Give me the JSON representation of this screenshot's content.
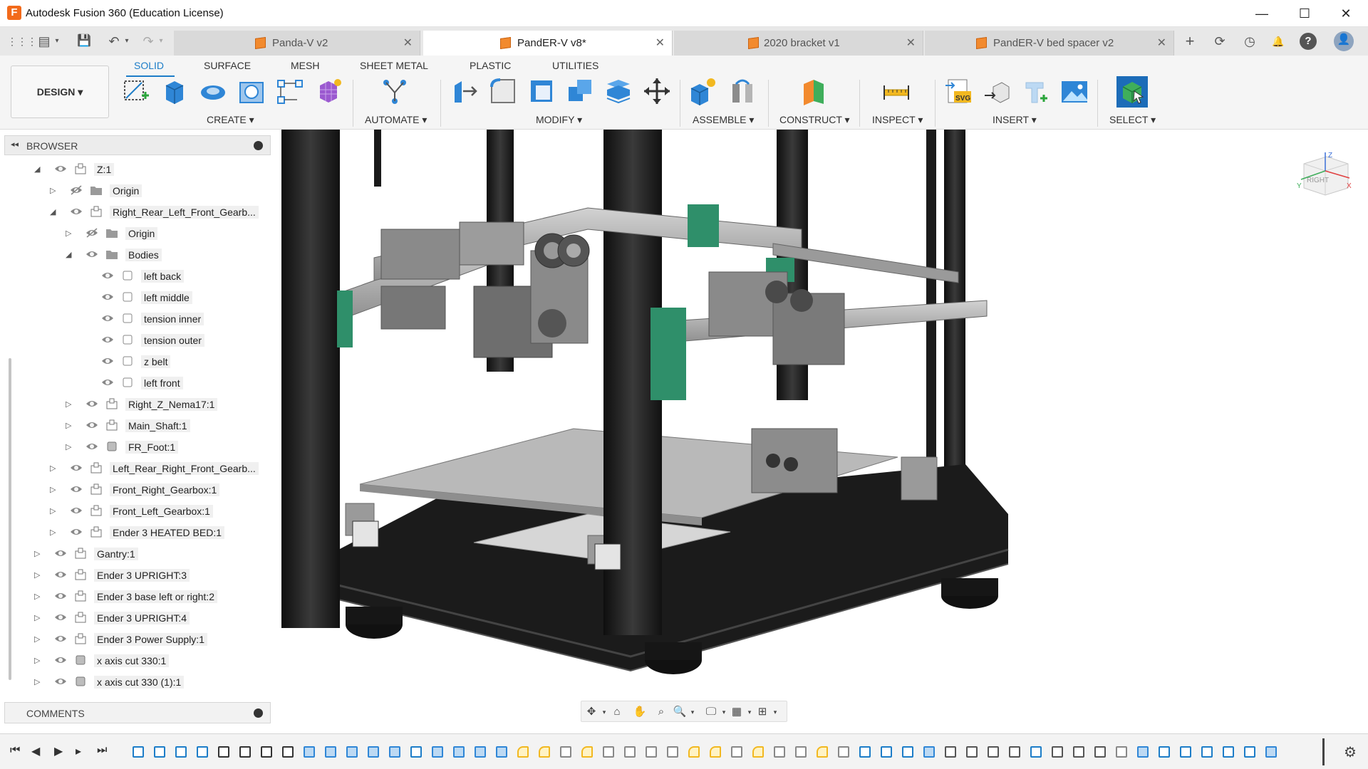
{
  "app": {
    "title": "Autodesk Fusion 360 (Education License)",
    "icon_letter": "F"
  },
  "window_controls": {
    "minimize": "—",
    "maximize": "☐",
    "close": "✕"
  },
  "quick_access": {
    "grid": "⋮⋮⋮",
    "file": "▤",
    "save": "💾",
    "undo": "↶",
    "redo": "↷"
  },
  "tabs": [
    {
      "label": "Panda-V v2",
      "active": false
    },
    {
      "label": "PandER-V v8*",
      "active": true
    },
    {
      "label": "2020 bracket v1",
      "active": false
    },
    {
      "label": "PandER-V bed spacer v2",
      "active": false
    }
  ],
  "tab_close": "✕",
  "right_icons": {
    "new_tab": "+",
    "sync": "⟳",
    "clock": "◷",
    "bell": "🔔",
    "help": "?",
    "avatar": "👤"
  },
  "toolbar": {
    "design_label": "DESIGN ▾",
    "workspace_tabs": [
      "SOLID",
      "SURFACE",
      "MESH",
      "SHEET METAL",
      "PLASTIC",
      "UTILITIES"
    ],
    "active_workspace": "SOLID",
    "groups": [
      "CREATE ▾",
      "AUTOMATE ▾",
      "MODIFY ▾",
      "ASSEMBLE ▾",
      "CONSTRUCT ▾",
      "INSPECT ▾",
      "INSERT ▾",
      "SELECT ▾"
    ]
  },
  "browser": {
    "title": "BROWSER",
    "collapse_icon": "◂◂",
    "nodes": [
      {
        "label": "Z:1",
        "level": 0,
        "expanded": true,
        "type": "component",
        "visible": true
      },
      {
        "label": "Origin",
        "level": 1,
        "expanded": false,
        "type": "folder",
        "visible": false
      },
      {
        "label": "Right_Rear_Left_Front_Gearb...",
        "level": 1,
        "expanded": true,
        "type": "component",
        "visible": true
      },
      {
        "label": "Origin",
        "level": 2,
        "expanded": false,
        "type": "folder",
        "visible": false
      },
      {
        "label": "Bodies",
        "level": 2,
        "expanded": true,
        "type": "folder",
        "visible": true
      },
      {
        "label": "left back",
        "level": 3,
        "expanded": null,
        "type": "body",
        "visible": true
      },
      {
        "label": "left middle",
        "level": 3,
        "expanded": null,
        "type": "body",
        "visible": true
      },
      {
        "label": "tension inner",
        "level": 3,
        "expanded": null,
        "type": "body",
        "visible": true
      },
      {
        "label": "tension outer",
        "level": 3,
        "expanded": null,
        "type": "body",
        "visible": true
      },
      {
        "label": "z belt",
        "level": 3,
        "expanded": null,
        "type": "body",
        "visible": true
      },
      {
        "label": "left front",
        "level": 3,
        "expanded": null,
        "type": "body",
        "visible": true
      },
      {
        "label": "Right_Z_Nema17:1",
        "level": 2,
        "expanded": false,
        "type": "component",
        "visible": true
      },
      {
        "label": "Main_Shaft:1",
        "level": 2,
        "expanded": false,
        "type": "component",
        "visible": true
      },
      {
        "label": "FR_Foot:1",
        "level": 2,
        "expanded": false,
        "type": "body-comp",
        "visible": true
      },
      {
        "label": "Left_Rear_Right_Front_Gearb...",
        "level": 1,
        "expanded": false,
        "type": "component",
        "visible": true
      },
      {
        "label": "Front_Right_Gearbox:1",
        "level": 1,
        "expanded": false,
        "type": "component",
        "visible": true
      },
      {
        "label": "Front_Left_Gearbox:1",
        "level": 1,
        "expanded": false,
        "type": "component",
        "visible": true
      },
      {
        "label": "Ender 3 HEATED BED:1",
        "level": 1,
        "expanded": false,
        "type": "component",
        "visible": true
      },
      {
        "label": "Gantry:1",
        "level": 0,
        "expanded": false,
        "type": "component",
        "visible": true
      },
      {
        "label": "Ender 3 UPRIGHT:3",
        "level": 0,
        "expanded": false,
        "type": "component",
        "visible": true
      },
      {
        "label": "Ender 3 base left or right:2",
        "level": 0,
        "expanded": false,
        "type": "component",
        "visible": true
      },
      {
        "label": "Ender 3 UPRIGHT:4",
        "level": 0,
        "expanded": false,
        "type": "component",
        "visible": true
      },
      {
        "label": "Ender 3 Power Supply:1",
        "level": 0,
        "expanded": false,
        "type": "component",
        "visible": true
      },
      {
        "label": "x axis cut 330:1",
        "level": 0,
        "expanded": false,
        "type": "body-comp",
        "visible": true
      },
      {
        "label": "x axis cut 330 (1):1",
        "level": 0,
        "expanded": false,
        "type": "body-comp",
        "visible": true
      }
    ]
  },
  "comments": {
    "title": "COMMENTS"
  },
  "viewcube": {
    "face": "RIGHT",
    "axis_z": "Z",
    "axis_x": "X",
    "axis_y": "Y"
  },
  "colors": {
    "accent": "#1d7dc8",
    "frame": "#1a1a1a",
    "part_gray": "#8a8a8a",
    "bracket_green": "#2f8f6a",
    "bed": "#b9b9b9"
  }
}
